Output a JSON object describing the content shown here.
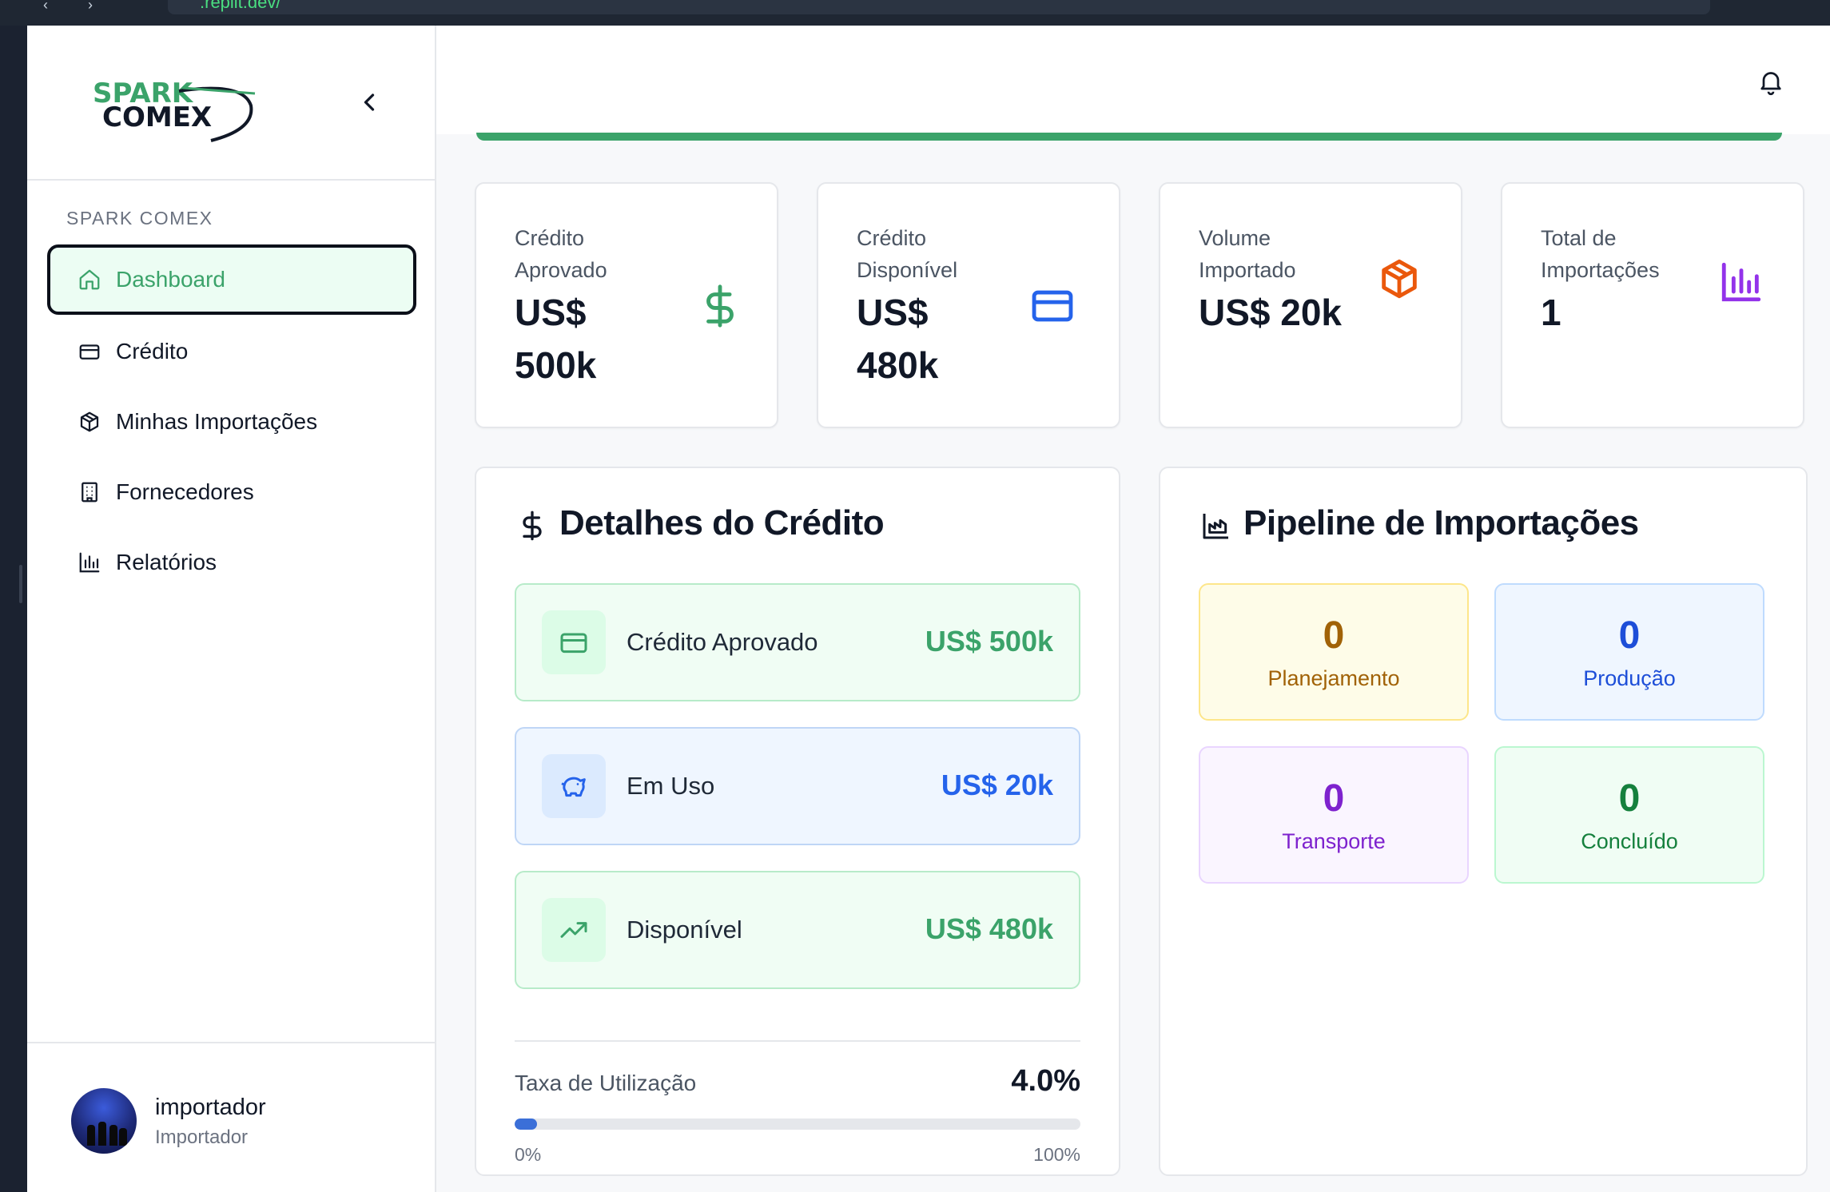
{
  "browser": {
    "url": ".replit.dev/"
  },
  "sidebar": {
    "logo_text_top": "SPARK",
    "logo_text_bottom": "COMEX",
    "section_label": "SPARK COMEX",
    "items": [
      {
        "label": "Dashboard",
        "icon": "home-icon",
        "active": true
      },
      {
        "label": "Crédito",
        "icon": "credit-card-icon",
        "active": false
      },
      {
        "label": "Minhas Importações",
        "icon": "package-icon",
        "active": false
      },
      {
        "label": "Fornecedores",
        "icon": "building-icon",
        "active": false
      },
      {
        "label": "Relatórios",
        "icon": "bar-chart-icon",
        "active": false
      }
    ],
    "user": {
      "name": "importador",
      "role": "Importador"
    }
  },
  "stats": [
    {
      "label": "Crédito Aprovado",
      "value": "US$ 500k",
      "icon": "dollar-icon",
      "color": "#3ba36a"
    },
    {
      "label": "Crédito Disponível",
      "value": "US$ 480k",
      "icon": "credit-card-icon",
      "color": "#2563eb"
    },
    {
      "label": "Volume Importado",
      "value": "US$ 20k",
      "icon": "package-icon",
      "color": "#ea580c"
    },
    {
      "label": "Total de Importações",
      "value": "1",
      "icon": "bar-chart-icon",
      "color": "#9333ea"
    }
  ],
  "credit_details": {
    "title": "Detalhes do Crédito",
    "rows": [
      {
        "label": "Crédito Aprovado",
        "value": "US$ 500k",
        "icon": "credit-card-icon",
        "color": "#3ba36a",
        "bg": "#f0fdf4",
        "border": "#b7ebc9",
        "icon_bg": "#dcfce7"
      },
      {
        "label": "Em Uso",
        "value": "US$ 20k",
        "icon": "piggy-bank-icon",
        "color": "#2563eb",
        "bg": "#eff6ff",
        "border": "#bfd6f6",
        "icon_bg": "#dbeafe"
      },
      {
        "label": "Disponível",
        "value": "US$ 480k",
        "icon": "trending-up-icon",
        "color": "#3ba36a",
        "bg": "#f0fdf4",
        "border": "#b7ebc9",
        "icon_bg": "#dcfce7"
      }
    ],
    "utilization_label": "Taxa de Utilização",
    "utilization_value": "4.0%",
    "utilization_fraction": 0.04,
    "min_label": "0%",
    "max_label": "100%"
  },
  "pipeline": {
    "title": "Pipeline de Importações",
    "stages": [
      {
        "count": "0",
        "name": "Planejamento",
        "color": "#a16207",
        "bg": "#fefce8",
        "border": "#fde68a"
      },
      {
        "count": "0",
        "name": "Produção",
        "color": "#1d4ed8",
        "bg": "#eff6ff",
        "border": "#bfdbfe"
      },
      {
        "count": "0",
        "name": "Transporte",
        "color": "#7e22ce",
        "bg": "#faf5ff",
        "border": "#e9d5ff"
      },
      {
        "count": "0",
        "name": "Concluído",
        "color": "#15803d",
        "bg": "#f0fdf4",
        "border": "#bbf7d0"
      }
    ]
  }
}
